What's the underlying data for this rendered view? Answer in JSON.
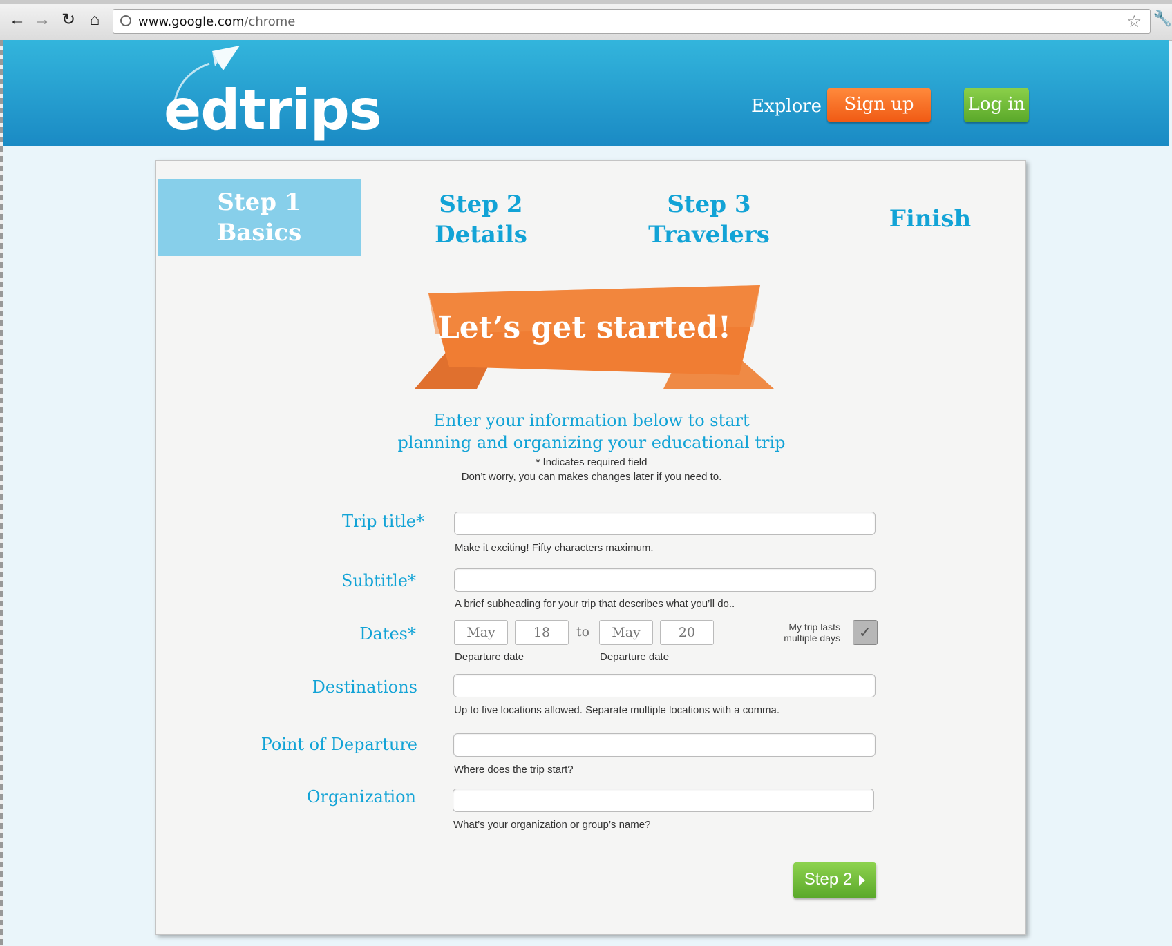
{
  "browser": {
    "url_host": "www.google.com",
    "url_path": "/chrome"
  },
  "header": {
    "logo": "edtrips",
    "explore": "Explore",
    "signup": "Sign up",
    "login": "Log in"
  },
  "steps": [
    {
      "num": "Step 1",
      "name": "Basics"
    },
    {
      "num": "Step 2",
      "name": "Details"
    },
    {
      "num": "Step 3",
      "name": "Travelers"
    },
    {
      "name": "Finish"
    }
  ],
  "banner": "Let’s get started!",
  "intro": {
    "line1": "Enter your information below to start",
    "line2": "planning and organizing your educational trip",
    "required_note": "* Indicates required field",
    "change_note": "Don’t worry, you can makes changes later if you need to."
  },
  "form": {
    "trip_title": {
      "label": "Trip title*",
      "hint": "Make it exciting! Fifty characters maximum."
    },
    "subtitle": {
      "label": "Subtitle*",
      "hint": "A brief subheading for your trip that describes what you’ll do.."
    },
    "dates": {
      "label": "Dates*",
      "start_month": "May",
      "start_day": "18",
      "to": "to",
      "end_month": "May",
      "end_day": "20",
      "start_hint": "Departure date",
      "end_hint": "Departure date",
      "multi_label": "My trip lasts multiple days",
      "multi_checked": true
    },
    "destinations": {
      "label": "Destinations",
      "hint": "Up to five locations allowed. Separate multiple locations with a comma."
    },
    "departure": {
      "label": "Point of Departure",
      "hint": "Where does the trip start?"
    },
    "organization": {
      "label": "Organization",
      "hint": "What’s your organization or group’s name?"
    }
  },
  "next_button": "Step 2",
  "colors": {
    "header_blue": "#1a8ac4",
    "accent_blue": "#12a3d6",
    "orange": "#f05a14",
    "green": "#5aa82a"
  }
}
